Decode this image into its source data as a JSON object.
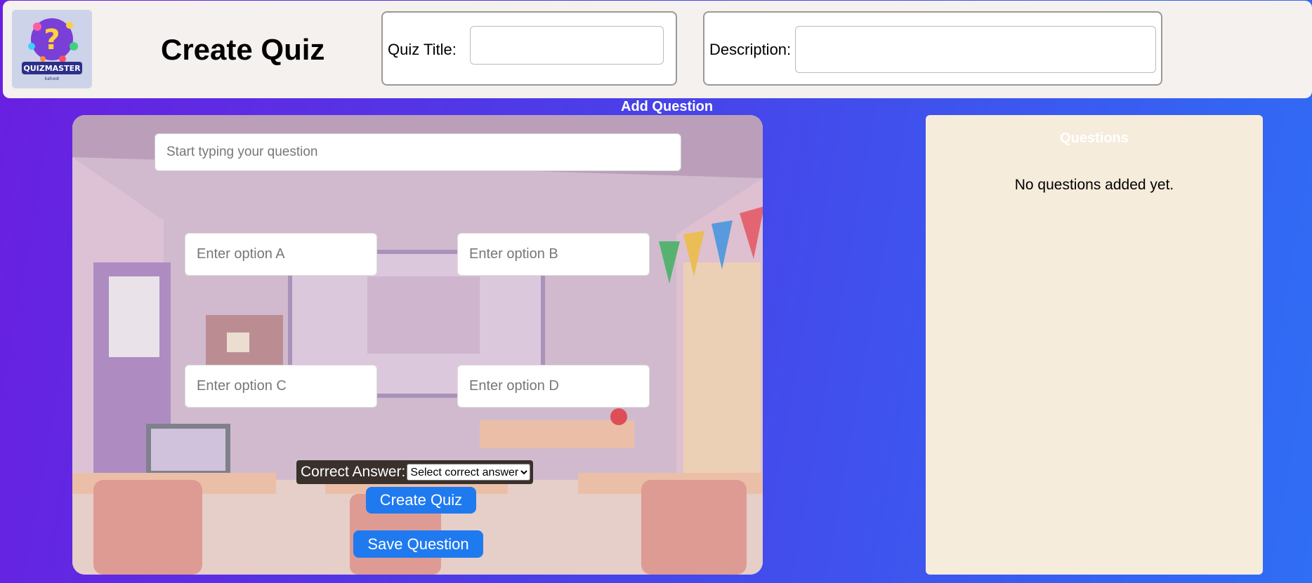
{
  "header": {
    "logo": {
      "icon": "quizmaster-logo",
      "brand": "QUIZMASTER",
      "sub": "kahoot"
    },
    "title": "Create Quiz",
    "quiz_title": {
      "label": "Quiz Title:",
      "value": ""
    },
    "description": {
      "label": "Description:",
      "value": ""
    }
  },
  "editor": {
    "section_label": "Add Question",
    "question_placeholder": "Start typing your question",
    "options": {
      "a_placeholder": "Enter option A",
      "b_placeholder": "Enter option B",
      "c_placeholder": "Enter option C",
      "d_placeholder": "Enter option D"
    },
    "correct_answer": {
      "label": "Correct Answer:",
      "selected": "Select correct answer"
    },
    "create_button": "Create Quiz",
    "save_button": "Save Question",
    "background": "classroom-illustration"
  },
  "questions_panel": {
    "heading": "Questions",
    "empty_text": "No questions added yet."
  },
  "colors": {
    "accent": "#1f7af0",
    "header_bg": "#f5f1ef",
    "questions_bg": "#f6ecdc",
    "gradient_start": "#6a1fe0",
    "gradient_end": "#2f6ef5"
  }
}
